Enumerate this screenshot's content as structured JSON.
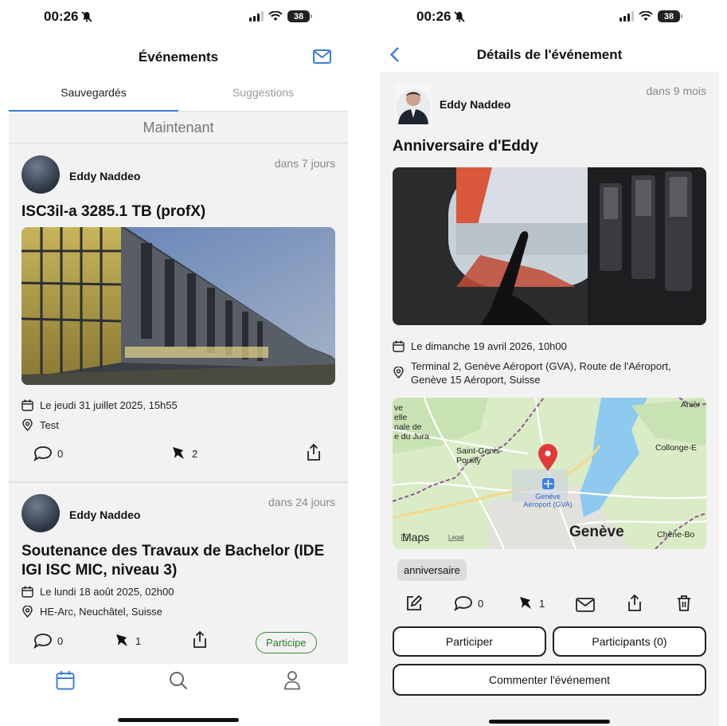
{
  "status_bar": {
    "time": "00:26",
    "battery": "38"
  },
  "left": {
    "nav_title": "Événements",
    "tabs": [
      {
        "label": "Sauvegardés",
        "active": true
      },
      {
        "label": "Suggestions",
        "active": false
      }
    ],
    "section_header": "Maintenant",
    "events": [
      {
        "author": "Eddy Naddeo",
        "relative_time": "dans 7 jours",
        "title": "ISC3il-a 3285.1 TB (profX)",
        "date": "Le jeudi 31 juillet 2025, 15h55",
        "location": "Test",
        "comments": "0",
        "pins": "2"
      },
      {
        "author": "Eddy Naddeo",
        "relative_time": "dans 24 jours",
        "title_line1": "Soutenance des Travaux de Bachelor (IDE",
        "title_line2": "IGI ISC MIC, niveau 3)",
        "date": "Le lundi 18 août 2025, 02h00",
        "location": "HE-Arc, Neuchâtel, Suisse",
        "comments": "0",
        "pins": "1",
        "status": "Participe"
      }
    ]
  },
  "right": {
    "nav_title": "Détails de l'événement",
    "author": "Eddy Naddeo",
    "relative_time": "dans 9 mois",
    "title": "Anniversaire d'Eddy",
    "date": "Le dimanche 19 avril 2026, 10h00",
    "location_line1": "Terminal 2, Genève Aéroport (GVA), Route de l'Aéroport,",
    "location_line2": "Genève 15 Aéroport, Suisse",
    "map_labels": {
      "saint_genis_1": "Saint-Genis-",
      "saint_genis_2": "Pouilly",
      "airport_1": "Genève",
      "airport_2": "Aéroport (GVA)",
      "geneve": "Genève",
      "collonge": "Collonge-E",
      "chene": "Chêne-Bo",
      "aniere": "Anièr",
      "jura_1": "ve",
      "jura_2": "elle",
      "jura_3": "nale de",
      "jura_4": "e du Jura",
      "maps": "Maps",
      "legal": "Legal"
    },
    "tag": "anniversaire",
    "comments": "0",
    "pins": "1",
    "buttons": {
      "participate": "Participer",
      "participants": "Participants (0)",
      "comment": "Commenter l'événement"
    }
  },
  "colors": {
    "accent": "#3b7fd9",
    "participe_green": "#2f7a2f",
    "map_water": "#8ec9ef",
    "map_land": "#d9ecc6",
    "border_purple": "#8b5a93"
  }
}
